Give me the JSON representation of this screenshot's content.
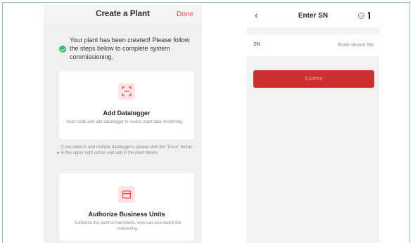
{
  "create_plant": {
    "title": "Create a Plant",
    "done_label": "Done",
    "created_message": "Your plant has been created! Please follow the steps below to complete system commissioning.",
    "datalogger_card": {
      "icon": "scan-icon",
      "title": "Add Datalogger",
      "description": "Scan code and add datalogger to realize plant data monitoring"
    },
    "hint": "If you need to add multiple dataloggers, please click the \"Done\" button in the upper right corner and add in the plant details",
    "business_card": {
      "icon": "store-icon",
      "title": "Authorize Business Units",
      "description": "Authorize the plant to merchants, who can also watch the monitoring."
    }
  },
  "enter_sn": {
    "back_icon": "back-icon",
    "title": "Enter SN",
    "target_icon": "target-icon",
    "more_icon": "more-icon",
    "sn_label": "SN",
    "sn_placeholder": "Enter device SN",
    "sn_value": "",
    "confirm_label": "Confirm"
  },
  "colors": {
    "accent_red": "#cc3131",
    "done_red": "#e0544c",
    "success_green": "#2dbe6a",
    "hint_orange": "#f0962a",
    "icon_bg_pink": "#fde5e3"
  }
}
